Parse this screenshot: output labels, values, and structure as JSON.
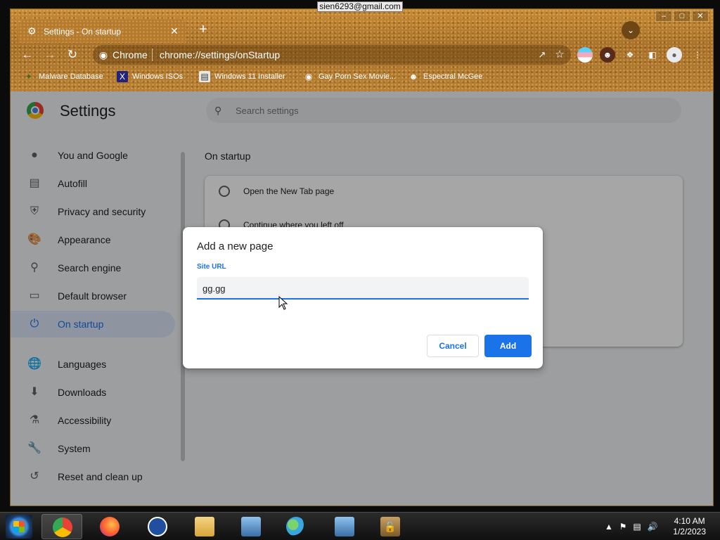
{
  "account": {
    "email": "sien6293@gmail.com"
  },
  "browser": {
    "tab_title": "Settings - On startup",
    "omnibox_host": "Chrome",
    "omnibox_url": "chrome://settings/onStartup",
    "bookmarks": [
      {
        "label": "Malware Database"
      },
      {
        "label": "Windows ISOs"
      },
      {
        "label": "Windows 11 Installer"
      },
      {
        "label": "Gay Porn Sex Movie..."
      },
      {
        "label": "Espectral McGee"
      }
    ]
  },
  "settings": {
    "title": "Settings",
    "search_placeholder": "Search settings",
    "nav": [
      {
        "label": "You and Google",
        "icon": "person-icon"
      },
      {
        "label": "Autofill",
        "icon": "clipboard-icon"
      },
      {
        "label": "Privacy and security",
        "icon": "shield-icon"
      },
      {
        "label": "Appearance",
        "icon": "palette-icon"
      },
      {
        "label": "Search engine",
        "icon": "search-icon"
      },
      {
        "label": "Default browser",
        "icon": "browser-icon"
      },
      {
        "label": "On startup",
        "icon": "power-icon",
        "active": true
      },
      {
        "label": "Languages",
        "icon": "globe-icon"
      },
      {
        "label": "Downloads",
        "icon": "download-icon"
      },
      {
        "label": "Accessibility",
        "icon": "accessibility-icon"
      },
      {
        "label": "System",
        "icon": "wrench-icon"
      },
      {
        "label": "Reset and clean up",
        "icon": "history-icon"
      }
    ],
    "section_title": "On startup",
    "options": [
      {
        "label": "Open the New Tab page"
      },
      {
        "label": "Continue where you left off"
      }
    ]
  },
  "dialog": {
    "title": "Add a new page",
    "field_label": "Site URL",
    "field_value": "gg.gg",
    "cancel_label": "Cancel",
    "add_label": "Add"
  },
  "taskbar": {
    "time": "4:10 AM",
    "date": "1/2/2023"
  }
}
